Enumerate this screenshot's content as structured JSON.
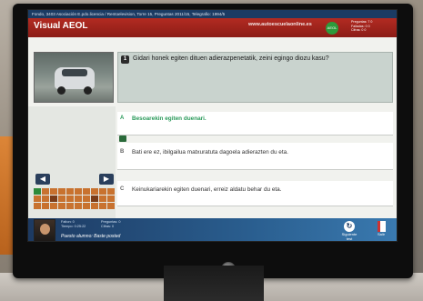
{
  "info_bar": "Fondo, 3403 Asociación E.pdo.licencia / Rentoelevision, Torre 15, Preguntas 2011/15, Telegrafio: 1994/5",
  "app_title": "Visual AEOL",
  "site_url": "www.autoescuelaonline.es",
  "green_badge": "AEOL",
  "stats": [
    "Preguntas: 7 0",
    "Falladas: 0 0",
    "Cifras: 0 0"
  ],
  "question": {
    "number": "1",
    "text": "Gidari honek egiten dituen adierazpenetatik, zeini egingo diozu kasu?"
  },
  "answers": [
    {
      "letter": "A",
      "text": "Besoarekin egiten duenari.",
      "selected": true
    },
    {
      "letter": "B",
      "text": "Bati ere ez, ibilgailua matxuratuta dagoela adierazten du eta.",
      "selected": false
    },
    {
      "letter": "C",
      "text": "Keinukariarekin egiten duenari, erreiz aldatu behar du eta.",
      "selected": false
    }
  ],
  "nav": {
    "prev_icon": "arrow-left-icon",
    "next_icon": "arrow-right-icon"
  },
  "status": {
    "items": [
      "Falton: 0",
      "Tiempo: 0:25:22"
    ],
    "items_right": [
      "Preguntas: 0",
      "Cifras: 0"
    ],
    "message": "Puesto alumno: Baste posted",
    "next_label": "Siguiente\ntest",
    "exit_label": "Salir"
  }
}
